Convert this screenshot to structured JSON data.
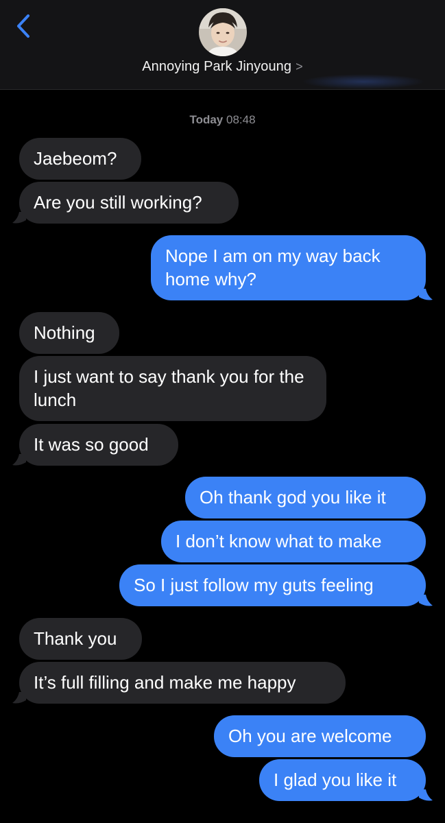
{
  "header": {
    "contact_name": "Annoying Park Jinyoung",
    "chevron": ">",
    "back_icon": "chevron-left-icon",
    "accent_color": "#3b82f6"
  },
  "conversation": {
    "timestamp_day": "Today",
    "timestamp_time": "08:48",
    "messages": [
      {
        "direction": "incoming",
        "text": "Jaebeom?"
      },
      {
        "direction": "incoming",
        "text": "Are you still working?"
      },
      {
        "direction": "outgoing",
        "text": "Nope I am on my way back home why?"
      },
      {
        "direction": "incoming",
        "text": "Nothing"
      },
      {
        "direction": "incoming",
        "text": "I just want to say thank you for the lunch"
      },
      {
        "direction": "incoming",
        "text": "It was so good"
      },
      {
        "direction": "outgoing",
        "text": "Oh thank god you like it"
      },
      {
        "direction": "outgoing",
        "text": "I don’t know what to make"
      },
      {
        "direction": "outgoing",
        "text": "So I just follow my guts feeling"
      },
      {
        "direction": "incoming",
        "text": "Thank you"
      },
      {
        "direction": "incoming",
        "text": "It’s full filling and make me happy"
      },
      {
        "direction": "outgoing",
        "text": "Oh you are welcome"
      },
      {
        "direction": "outgoing",
        "text": "I glad you like it"
      }
    ]
  }
}
